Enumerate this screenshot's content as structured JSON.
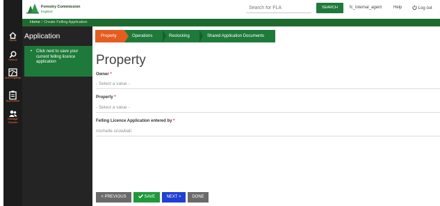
{
  "header": {
    "logo_title": "Forestry Commission",
    "logo_sub": "England",
    "search_placeholder": "Search for FLA",
    "search_button": "SEARCH",
    "user": "fc_internal_agent",
    "help": "Help",
    "logout": "Log out"
  },
  "breadcrumb": {
    "home": "Home",
    "separator": "/",
    "current": "Create Felling Application"
  },
  "rail": {
    "items": [
      {
        "label": "Home",
        "icon": "home-icon"
      },
      {
        "label": "Search",
        "icon": "search-icon"
      },
      {
        "label": "Add Property",
        "icon": "map-icon"
      },
      {
        "label": "Application",
        "icon": "clipboard-icon"
      },
      {
        "label": "Manage Owners",
        "icon": "users-icon"
      }
    ]
  },
  "sidebar": {
    "title": "Application",
    "help_text": "Click next to save your current felling licence application"
  },
  "tabs": [
    {
      "label": "Property",
      "active": true
    },
    {
      "label": "Operations",
      "active": false
    },
    {
      "label": "Restocking",
      "active": false
    },
    {
      "label": "Shared Application Documents",
      "active": false
    }
  ],
  "form": {
    "title": "Property",
    "required_mark": "*",
    "fields": [
      {
        "label": "Owner",
        "value": "- Select a value -"
      },
      {
        "label": "Property",
        "value": "- Select a value -"
      },
      {
        "label": "Felling Licence Application entered by",
        "value": "michelle snowball"
      }
    ]
  },
  "buttons": {
    "previous": "< PREVIOUS",
    "save": "SAVE",
    "next": "NEXT >",
    "done": "DONE"
  },
  "colors": {
    "brand_green": "#1e7a3a",
    "accent_orange": "#e65c1e",
    "next_blue": "#1f3fd6",
    "rail": "#1c1c1c"
  }
}
